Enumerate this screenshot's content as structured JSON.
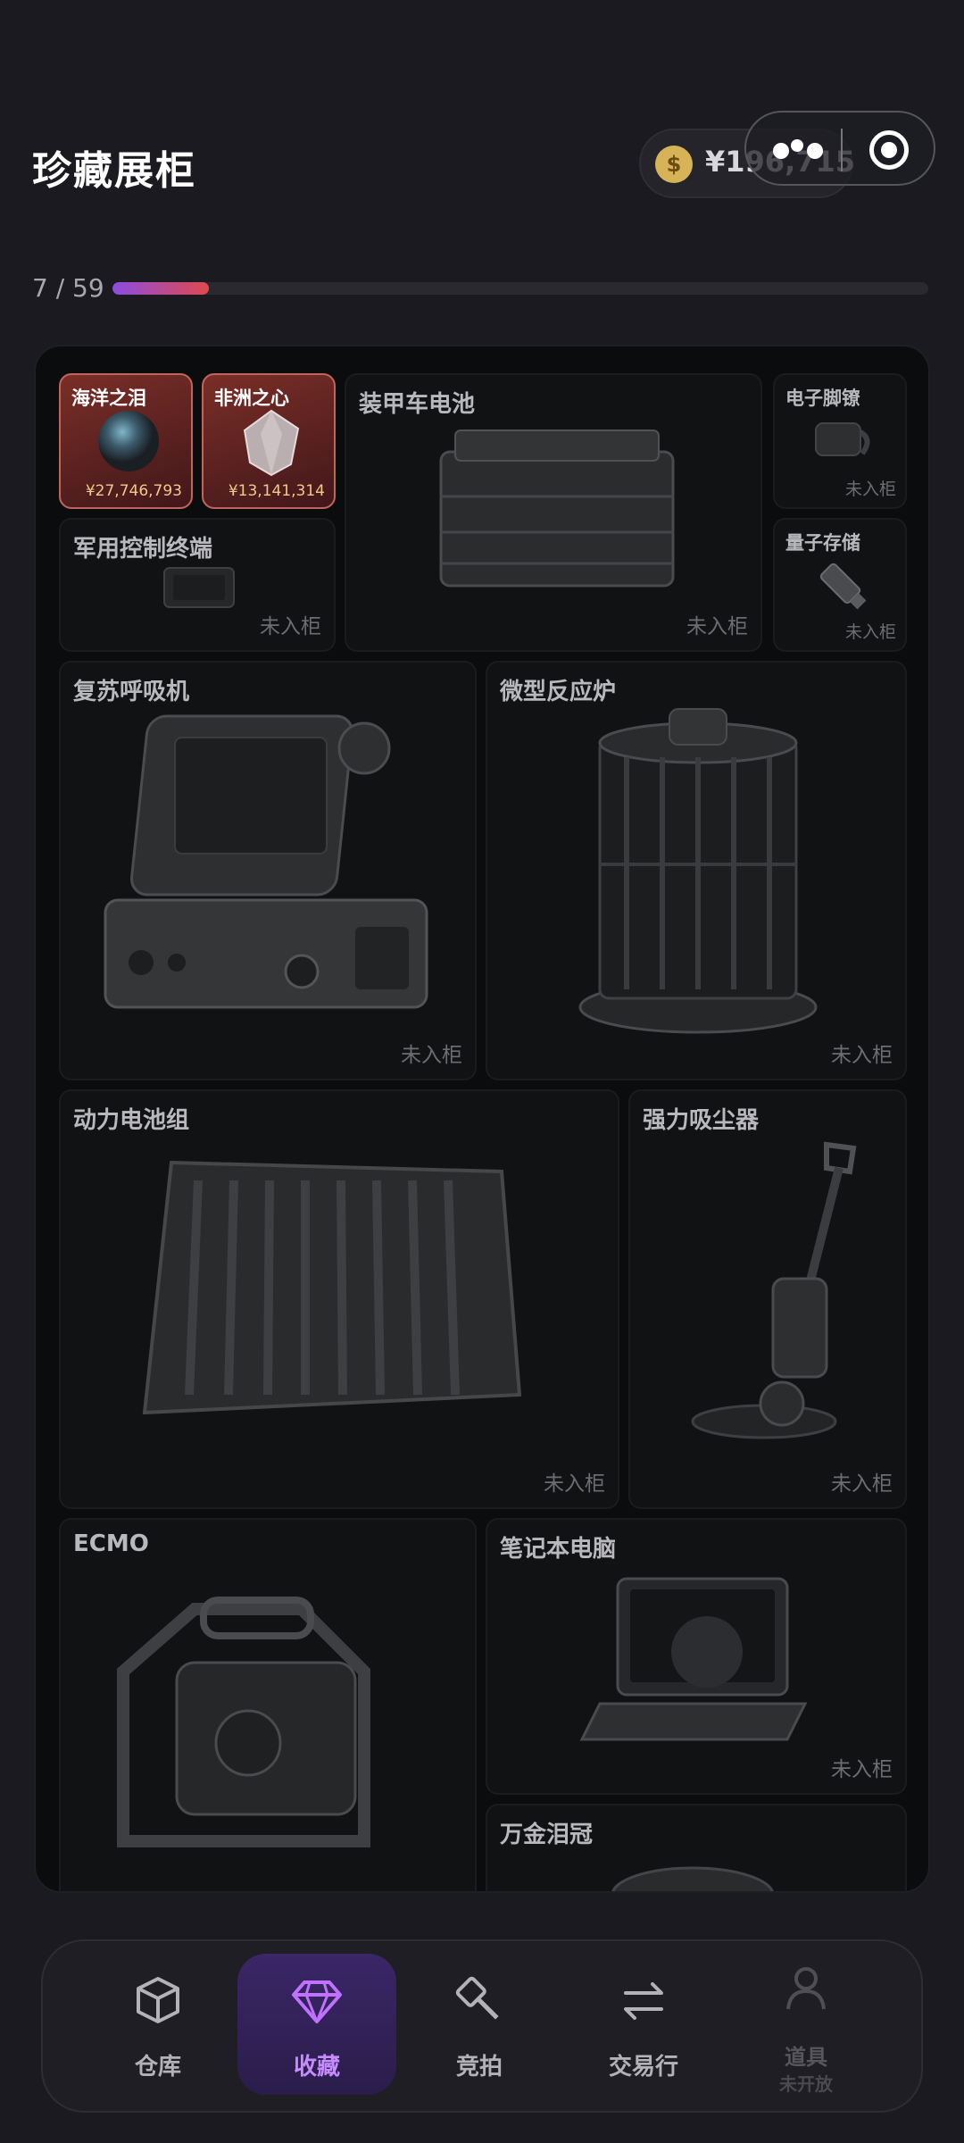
{
  "header": {
    "title": "珍藏展柜",
    "balance": "¥196,715",
    "coin_symbol": "$"
  },
  "progress": {
    "text": "7 / 59",
    "collected": 7,
    "total": 59
  },
  "colors": {
    "accent": "#9b5cf6",
    "owned_border": "#c0655c",
    "coin": "#d7b358"
  },
  "cabinet": {
    "items": [
      {
        "name": "海洋之泪",
        "status": "¥27,746,793",
        "owned": true
      },
      {
        "name": "非洲之心",
        "status": "¥13,141,314",
        "owned": true
      },
      {
        "name": "装甲车电池",
        "status": "未入柜",
        "owned": false
      },
      {
        "name": "电子脚镣",
        "status": "未入柜",
        "owned": false
      },
      {
        "name": "军用控制终端",
        "status": "未入柜",
        "owned": false
      },
      {
        "name": "量子存储",
        "status": "未入柜",
        "owned": false
      },
      {
        "name": "复苏呼吸机",
        "status": "未入柜",
        "owned": false
      },
      {
        "name": "微型反应炉",
        "status": "未入柜",
        "owned": false
      },
      {
        "name": "动力电池组",
        "status": "未入柜",
        "owned": false
      },
      {
        "name": "强力吸尘器",
        "status": "未入柜",
        "owned": false
      },
      {
        "name": "ECMO",
        "status": "",
        "owned": false
      },
      {
        "name": "笔记本电脑",
        "status": "未入柜",
        "owned": false
      },
      {
        "name": "万金泪冠",
        "status": "",
        "owned": false
      }
    ]
  },
  "nav": {
    "items": [
      {
        "label": "仓库",
        "icon": "box-icon",
        "active": false
      },
      {
        "label": "收藏",
        "icon": "diamond-icon",
        "active": true
      },
      {
        "label": "竞拍",
        "icon": "gavel-icon",
        "active": false
      },
      {
        "label": "交易行",
        "icon": "swap-arrows-icon",
        "active": false
      },
      {
        "label": "道具",
        "sub": "未开放",
        "icon": "person-icon",
        "active": false
      }
    ]
  }
}
